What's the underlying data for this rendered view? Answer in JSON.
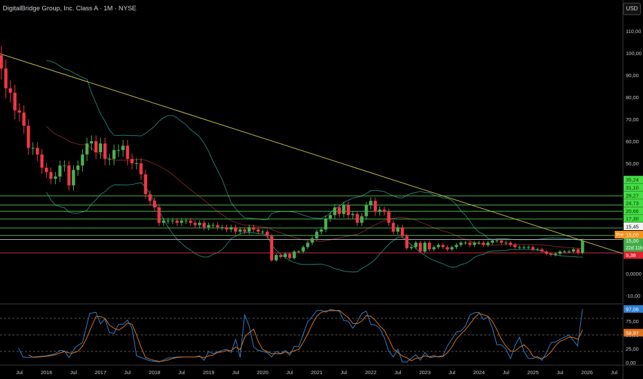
{
  "header": {
    "title": "DigitalBridge Group, Inc. Class A · 1M · NYSE",
    "currency_button": "USD"
  },
  "colors": {
    "up": "#4CAF50",
    "down": "#F23645",
    "level": "#5ccf5c",
    "level_label_bg": "#44dd44",
    "white_level": "#cfcfcf",
    "support": "#d12f3a",
    "trendline": "#c8c045",
    "band": "#1f7f74",
    "basis": "#7a2424",
    "k_line": "#2f7fd0",
    "d_line": "#e0731e",
    "pre": "#f7931a",
    "current": "#3fae4a"
  },
  "chart_data": {
    "type": "candlestick",
    "title": "DigitalBridge Group, Inc. Class A · 1M · NYSE",
    "x_unit": "months since 2015-03",
    "first_open": 99,
    "closes": [
      93,
      84,
      82,
      74,
      73,
      67,
      57,
      57,
      54,
      48,
      46,
      43,
      44,
      49,
      49,
      40,
      47,
      49,
      54,
      59,
      60,
      55,
      59,
      52,
      52,
      56,
      56,
      58,
      52,
      50,
      50,
      45,
      36,
      33,
      30,
      23,
      24,
      24,
      24,
      23,
      24,
      24,
      23,
      22,
      23,
      21,
      22,
      22,
      21,
      21,
      20,
      21,
      19,
      20,
      19,
      21,
      20,
      19,
      19,
      17,
      6,
      8.4,
      7.5,
      9,
      7,
      10,
      10,
      12,
      14,
      16,
      19,
      20,
      25,
      26.5,
      30,
      27,
      31,
      26.5,
      27,
      23,
      26,
      31,
      33,
      28,
      29,
      28,
      23,
      19,
      21,
      17,
      11.5,
      12,
      14,
      10,
      14,
      11,
      12,
      13,
      12,
      11,
      12,
      13,
      14,
      14,
      13,
      14,
      14,
      13,
      14,
      15,
      15,
      14,
      14,
      13,
      12,
      12,
      12,
      12,
      11,
      11,
      10,
      9,
      8.5,
      9,
      10,
      10,
      10,
      11,
      9.4,
      15
    ],
    "ylim": [
      -13,
      122
    ],
    "price_ticks": [
      {
        "v": 110,
        "label": "110,00"
      },
      {
        "v": 100,
        "label": "100,00"
      },
      {
        "v": 90,
        "label": "90,00"
      },
      {
        "v": 80,
        "label": "80,00"
      },
      {
        "v": 70,
        "label": "70,00"
      },
      {
        "v": 60,
        "label": "60,00"
      },
      {
        "v": 50,
        "label": "50,00"
      },
      {
        "v": 0,
        "label": "0,0000"
      },
      {
        "v": -10,
        "label": "-10,00"
      }
    ],
    "x_ticks": [
      {
        "i": 4,
        "label": "Jul"
      },
      {
        "i": 10,
        "label": "2016"
      },
      {
        "i": 16,
        "label": "Jul"
      },
      {
        "i": 22,
        "label": "2017"
      },
      {
        "i": 28,
        "label": "Jul"
      },
      {
        "i": 34,
        "label": "2018"
      },
      {
        "i": 40,
        "label": "Jul"
      },
      {
        "i": 46,
        "label": "2019"
      },
      {
        "i": 52,
        "label": "Jul"
      },
      {
        "i": 58,
        "label": "2020"
      },
      {
        "i": 64,
        "label": "Jul"
      },
      {
        "i": 70,
        "label": "2021"
      },
      {
        "i": 76,
        "label": "Jul"
      },
      {
        "i": 82,
        "label": "2022"
      },
      {
        "i": 88,
        "label": "Jul"
      },
      {
        "i": 94,
        "label": "2023"
      },
      {
        "i": 100,
        "label": "Jul"
      },
      {
        "i": 106,
        "label": "2024"
      },
      {
        "i": 112,
        "label": "Jul"
      },
      {
        "i": 118,
        "label": "2025"
      },
      {
        "i": 124,
        "label": "Jul"
      },
      {
        "i": 130,
        "label": "2026"
      },
      {
        "i": 136,
        "label": "Jul"
      }
    ],
    "levels": [
      {
        "v": 35.24,
        "label": "35,24",
        "kind": "level"
      },
      {
        "v": 31.1,
        "label": "31,10",
        "kind": "level"
      },
      {
        "v": 28.27,
        "label": "28,27",
        "kind": "level"
      },
      {
        "v": 24.73,
        "label": "24,73",
        "kind": "level"
      },
      {
        "v": 20.66,
        "label": "20,66",
        "kind": "level"
      },
      {
        "v": 17.3,
        "label": "17,30",
        "kind": "level"
      },
      {
        "v": 15.45,
        "label": "15,45",
        "kind": "white"
      }
    ],
    "premarket": {
      "tag": "Pre",
      "v": 15.0,
      "label": "15,00"
    },
    "last_price": {
      "v": 15.0,
      "label": "15,00",
      "countdown": "22d 11h"
    },
    "support": {
      "v": 9.38,
      "label": "9,38"
    },
    "trendline": [
      [
        -0.3,
        99.7
      ],
      [
        138,
        9
      ]
    ],
    "bollinger": {
      "period": 20,
      "mult": 2
    },
    "stoch_rsi": {
      "k_points": [
        [
          3.8,
          26
        ],
        [
          4.8,
          10
        ],
        [
          6,
          9
        ],
        [
          10,
          12
        ],
        [
          12,
          16
        ],
        [
          13,
          22
        ],
        [
          14,
          21
        ],
        [
          15,
          9
        ],
        [
          16.5,
          28
        ],
        [
          18,
          36
        ],
        [
          19.6,
          89
        ],
        [
          21,
          91
        ],
        [
          22,
          70
        ],
        [
          23,
          79
        ],
        [
          24,
          54
        ],
        [
          25,
          53
        ],
        [
          26,
          69
        ],
        [
          27,
          69
        ],
        [
          28,
          77
        ],
        [
          29,
          62
        ],
        [
          30,
          12
        ],
        [
          33,
          3
        ],
        [
          35,
          1
        ],
        [
          37,
          8
        ],
        [
          39,
          10
        ],
        [
          43,
          10
        ],
        [
          44,
          12
        ],
        [
          45,
          4
        ],
        [
          46,
          20
        ],
        [
          47,
          16
        ],
        [
          49,
          22
        ],
        [
          50,
          24
        ],
        [
          51,
          18
        ],
        [
          52,
          42
        ],
        [
          53,
          9
        ],
        [
          54,
          87
        ],
        [
          55,
          66
        ],
        [
          56,
          28
        ],
        [
          57,
          22
        ],
        [
          59,
          18
        ],
        [
          60,
          10
        ],
        [
          61,
          20
        ],
        [
          62,
          16
        ],
        [
          63,
          22
        ],
        [
          64,
          13
        ],
        [
          65,
          29
        ],
        [
          66,
          29
        ],
        [
          67,
          51
        ],
        [
          68,
          74
        ],
        [
          68.6,
          79
        ],
        [
          70,
          94
        ],
        [
          71,
          95
        ],
        [
          72,
          91
        ],
        [
          73,
          96
        ],
        [
          75,
          93
        ],
        [
          76,
          76
        ],
        [
          77,
          75
        ],
        [
          78,
          62
        ],
        [
          79,
          74
        ],
        [
          80,
          89
        ],
        [
          81,
          93
        ],
        [
          82,
          69
        ],
        [
          83,
          68
        ],
        [
          84,
          62
        ],
        [
          85,
          45
        ],
        [
          86,
          20
        ],
        [
          87,
          10
        ],
        [
          88,
          24
        ],
        [
          89,
          1
        ],
        [
          90,
          1
        ],
        [
          92,
          14
        ],
        [
          93,
          4
        ],
        [
          94,
          18
        ],
        [
          95,
          9
        ],
        [
          97,
          11
        ],
        [
          98,
          12
        ],
        [
          99,
          30
        ],
        [
          101,
          55
        ],
        [
          102,
          57
        ],
        [
          103,
          66
        ],
        [
          104,
          86
        ],
        [
          105,
          90
        ],
        [
          106,
          91
        ],
        [
          107,
          78
        ],
        [
          108,
          83
        ],
        [
          109,
          62
        ],
        [
          110,
          32
        ],
        [
          111,
          32
        ],
        [
          112,
          24
        ],
        [
          113,
          7
        ],
        [
          114,
          30
        ],
        [
          115,
          46
        ],
        [
          116,
          20
        ],
        [
          117,
          7
        ],
        [
          118,
          7
        ],
        [
          119,
          11
        ],
        [
          120,
          4
        ],
        [
          121,
          18
        ],
        [
          122,
          36
        ],
        [
          123,
          37
        ],
        [
          124,
          42
        ],
        [
          125,
          46
        ],
        [
          126,
          50
        ],
        [
          127.9,
          30
        ],
        [
          129,
          97.06
        ]
      ],
      "k_last": {
        "v": 97.06,
        "label": "97,06"
      },
      "d_last": {
        "v": 58.97,
        "label": "58,97"
      },
      "dashed_levels": [
        80,
        50,
        20
      ],
      "ticks": [
        {
          "v": 75,
          "label": "75,00"
        },
        {
          "v": 50,
          "label": "50,00"
        },
        {
          "v": 25,
          "label": "25,00"
        },
        {
          "v": 0,
          "label": "0,00"
        }
      ]
    }
  }
}
